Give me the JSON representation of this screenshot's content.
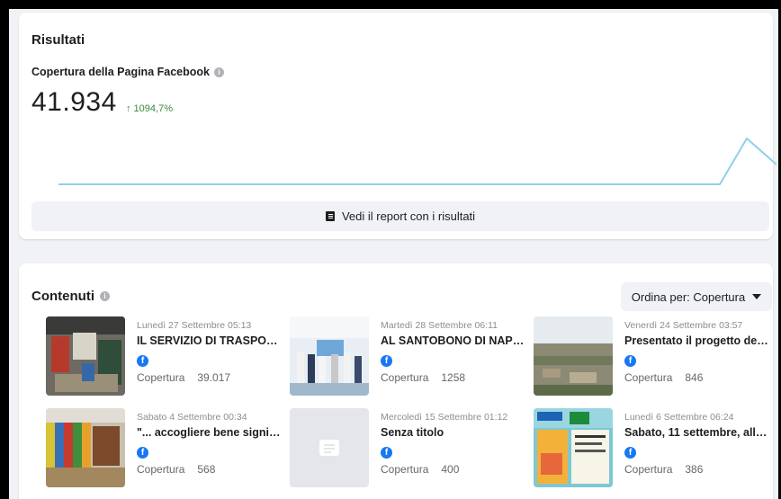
{
  "results": {
    "title": "Risultati",
    "metric_label": "Copertura della Pagina Facebook",
    "metric_value": "41.934",
    "metric_delta": "↑ 1094,7%",
    "report_button": "Vedi il report con i risultati",
    "trend_color": "#8fd0ea"
  },
  "content": {
    "title": "Contenuti",
    "sort_label": "Ordina per: Copertura",
    "stat_label": "Copertura",
    "posts": [
      {
        "date": "Lunedì 27 Settembre 05:13",
        "title": "IL SERVIZIO DI TRASPORTO",
        "reach": "39.017"
      },
      {
        "date": "Martedì 28 Settembre 06:11",
        "title": "AL SANTOBONO DI NAPOLI",
        "reach": "1258"
      },
      {
        "date": "Venerdì 24 Settembre 03:57",
        "title": "Presentato il progetto del …",
        "reach": "846"
      },
      {
        "date": "Sabato 4 Settembre 00:34",
        "title": "\"... accogliere bene signifi...",
        "reach": "568"
      },
      {
        "date": "Mercoledì 15 Settembre 01:12",
        "title": "Senza titolo",
        "reach": "400"
      },
      {
        "date": "Lunedì 6 Settembre 06:24",
        "title": "Sabato, 11 settembre, all…",
        "reach": "386"
      }
    ]
  }
}
